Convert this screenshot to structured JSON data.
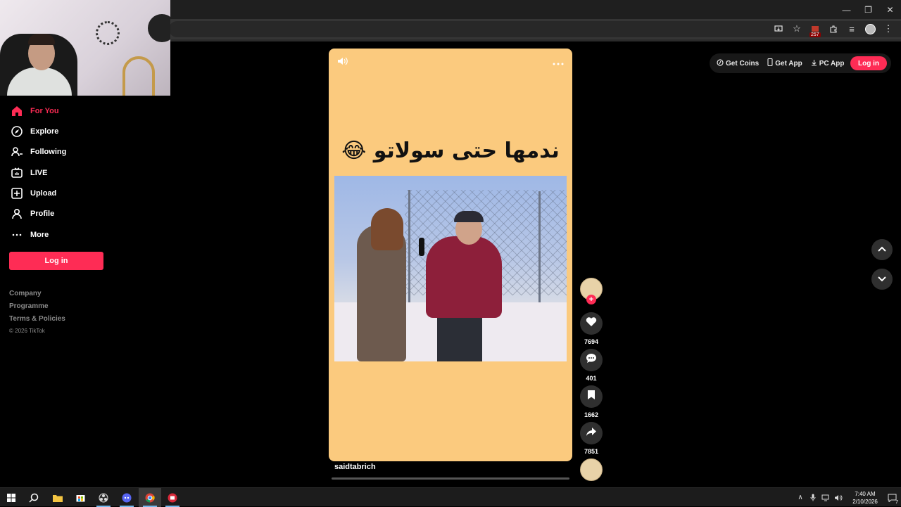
{
  "sidebar": {
    "items": [
      {
        "label": "For You",
        "icon": "home-icon"
      },
      {
        "label": "Explore",
        "icon": "compass-icon"
      },
      {
        "label": "Following",
        "icon": "user-follow-icon"
      },
      {
        "label": "LIVE",
        "icon": "live-icon"
      },
      {
        "label": "Upload",
        "icon": "plus-square-icon"
      },
      {
        "label": "Profile",
        "icon": "person-icon"
      },
      {
        "label": "More",
        "icon": "ellipsis-icon"
      }
    ],
    "login_label": "Log in",
    "footer": [
      "Company",
      "Programme",
      "Terms & Policies"
    ],
    "copyright": "© 2026 TikTok"
  },
  "topbar": {
    "get_coins": "Get Coins",
    "get_app": "Get App",
    "pc_app": "PC App",
    "login": "Log in"
  },
  "video": {
    "caption": "ندمها حتى سولاتو 😂",
    "username": "saidtabrich",
    "progress": 0.0
  },
  "actions": {
    "likes": "7694",
    "comments": "401",
    "saves": "1662",
    "shares": "7851"
  },
  "browser": {
    "extension_badge": "257"
  },
  "taskbar": {
    "time": "7:40 AM",
    "date": "2/10/2026",
    "notification_count": "7"
  },
  "colors": {
    "brand": "#fe2c55",
    "video_bg": "#fbca7e",
    "page_bg": "#000000"
  }
}
